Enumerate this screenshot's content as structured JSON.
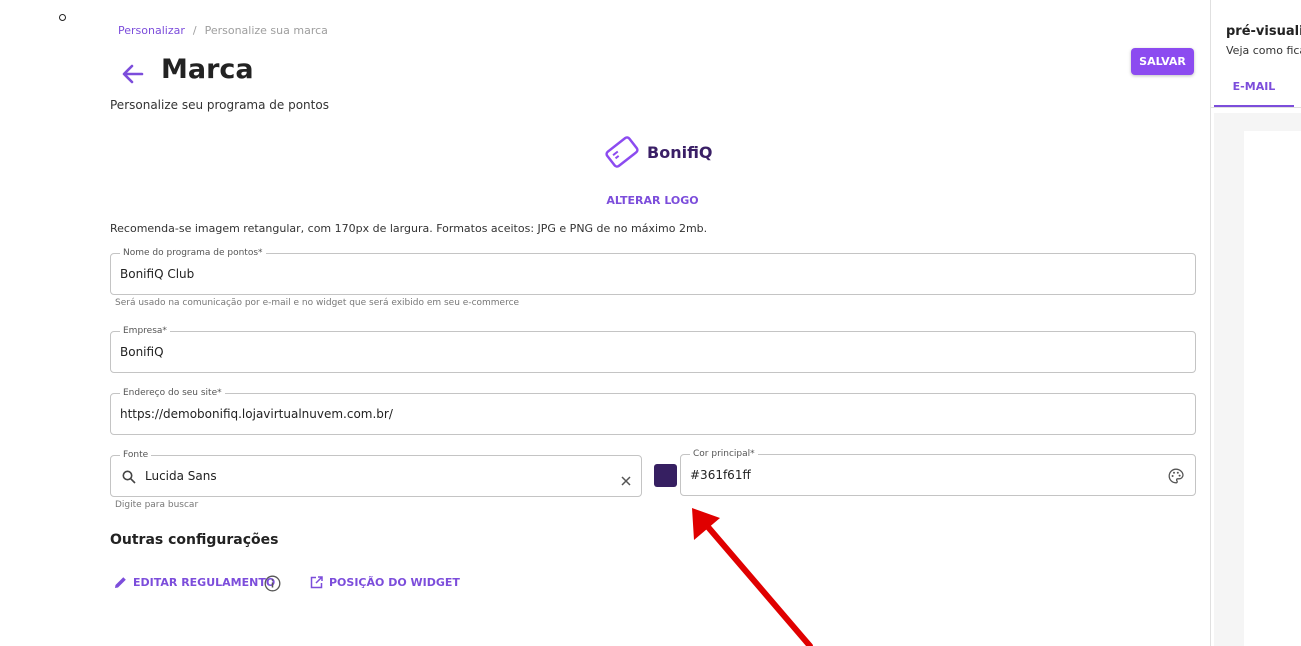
{
  "breadcrumb": {
    "parent": "Personalizar",
    "separator": "/",
    "current": "Personalize sua marca"
  },
  "header": {
    "title": "Marca",
    "subtitle": "Personalize seu programa de pontos",
    "save_label": "SALVAR"
  },
  "logo": {
    "text": "BonifiQ",
    "change_label": "ALTERAR LOGO",
    "recommendation": "Recomenda-se imagem retangular, com 170px de largura. Formatos aceitos: JPG e PNG de no máximo 2mb."
  },
  "form": {
    "program_name": {
      "label": "Nome do programa de pontos*",
      "value": "BonifiQ Club",
      "helper": "Será usado na comunicação por e-mail e no widget que será exibido em seu e-commerce"
    },
    "company": {
      "label": "Empresa*",
      "value": "BonifiQ"
    },
    "site": {
      "label": "Endereço do seu site*",
      "value": "https://demobonifiq.lojavirtualnuvem.com.br/"
    },
    "font": {
      "label": "Fonte",
      "value": "Lucida Sans",
      "helper": "Digite para buscar"
    },
    "color": {
      "label": "Cor principal*",
      "value": "#361f61ff",
      "swatch": "#361f61"
    }
  },
  "other": {
    "title": "Outras configurações",
    "edit_rules": "EDITAR REGULAMENTO",
    "widget_position": "POSIÇÃO DO WIDGET"
  },
  "preview": {
    "title": "pré-visuali",
    "subtitle": "Veja como fica",
    "tab_email": "E-MAIL"
  },
  "colors": {
    "accent": "#7c4ddb",
    "button": "#8c4bf0",
    "arrow": "#e00000"
  }
}
